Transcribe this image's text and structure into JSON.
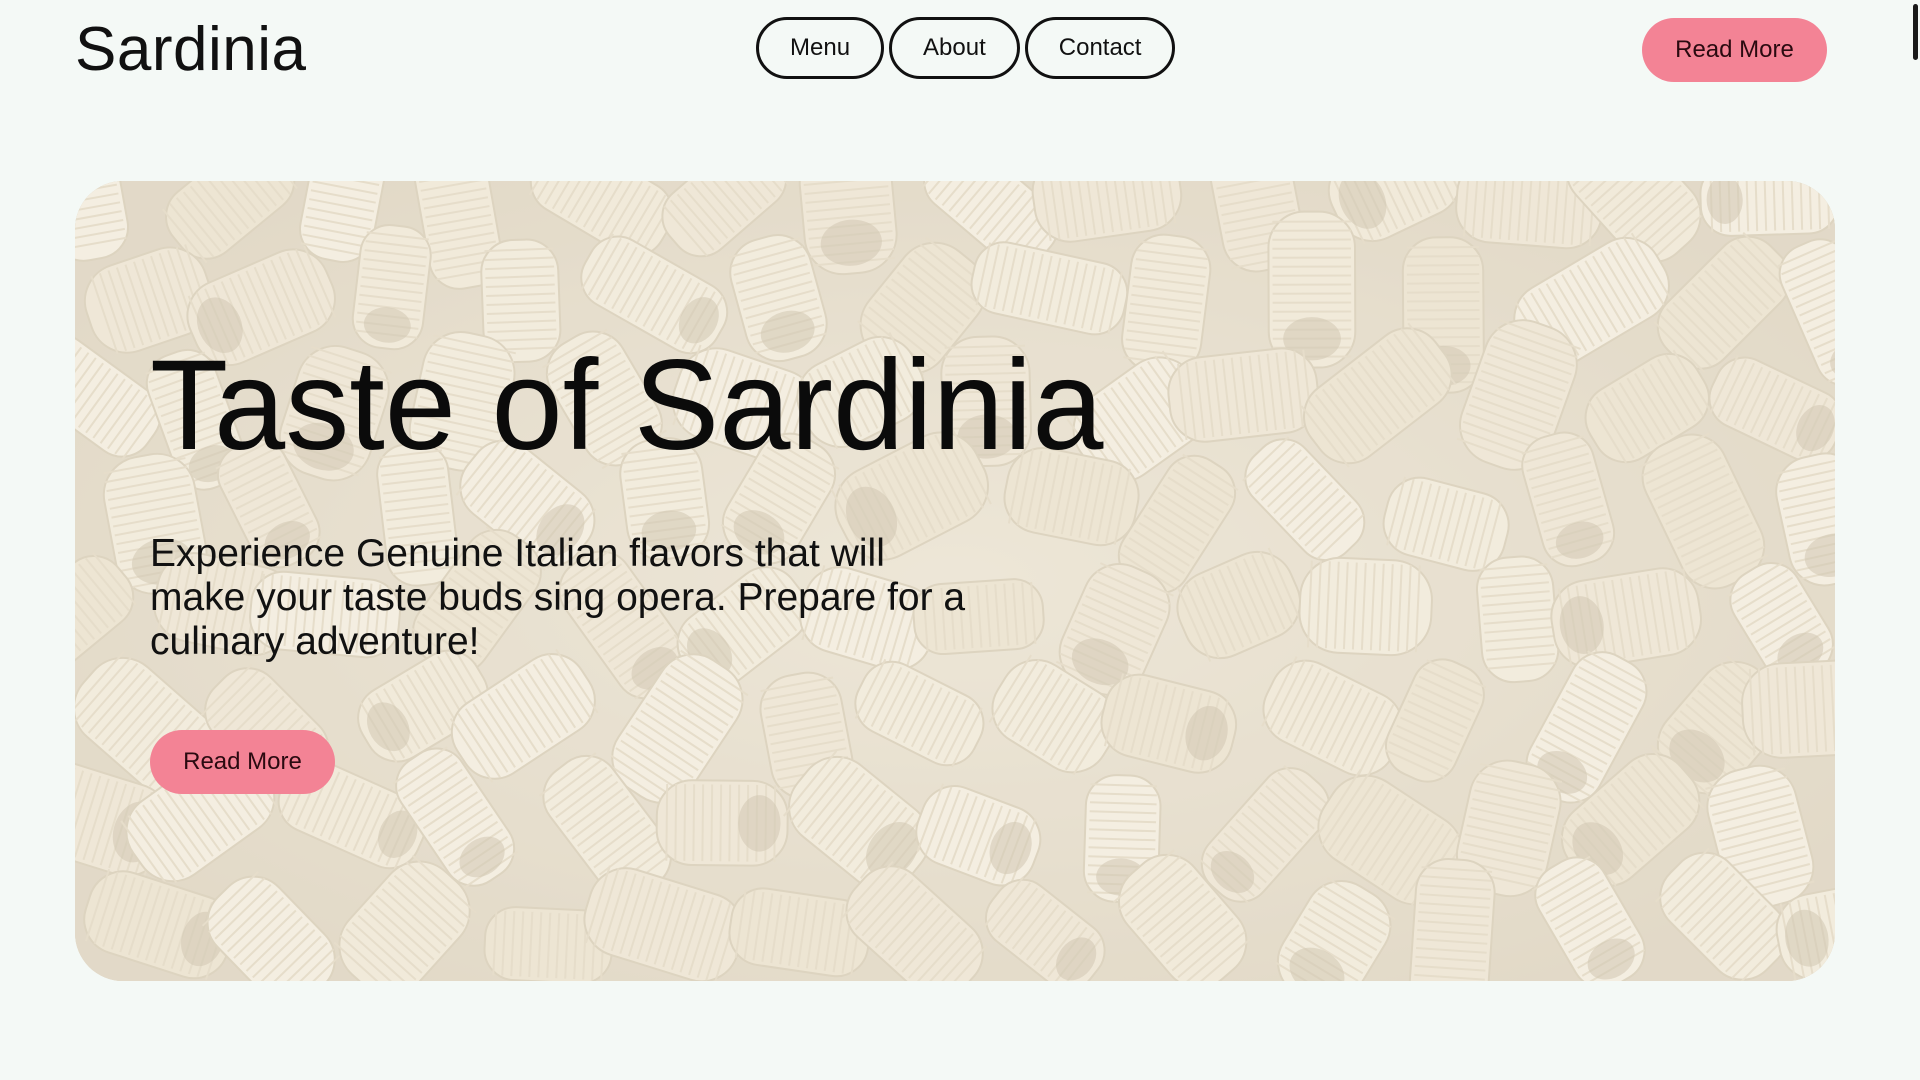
{
  "header": {
    "brand": "Sardinia",
    "nav": [
      {
        "label": "Menu"
      },
      {
        "label": "About"
      },
      {
        "label": "Contact"
      }
    ],
    "cta_label": "Read More"
  },
  "hero": {
    "title": "Taste of Sardinia",
    "description": "Experience Genuine Italian flavors that will make your taste buds sing opera. Prepare for a culinary adventure!",
    "cta_label": "Read More",
    "background": "pasta-photo"
  },
  "colors": {
    "page_background": "#f4f9f6",
    "accent_pink": "#f38395",
    "text": "#111111"
  }
}
